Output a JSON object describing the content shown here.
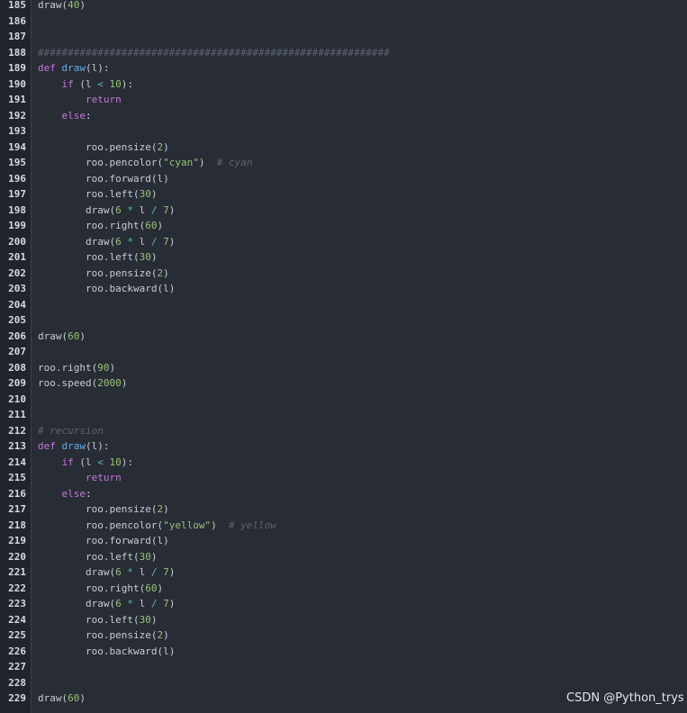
{
  "colors": {
    "background": "#282c34",
    "gutter": "#21252b",
    "line_number": "#d7dae0",
    "plain": "#c8ccd4",
    "keyword": "#c678dd",
    "function": "#61afef",
    "number": "#98c379",
    "string": "#98c379",
    "operator": "#56b6c2",
    "comment": "#5c6370"
  },
  "watermark": "CSDN @Python_trys",
  "lines": [
    {
      "num": "185",
      "tokens": [
        {
          "t": "draw(",
          "c": "plain"
        },
        {
          "t": "40",
          "c": "num"
        },
        {
          "t": ")",
          "c": "plain"
        }
      ]
    },
    {
      "num": "186",
      "tokens": []
    },
    {
      "num": "187",
      "tokens": []
    },
    {
      "num": "188",
      "tokens": [
        {
          "t": "###########################################################",
          "c": "com"
        }
      ]
    },
    {
      "num": "189",
      "tokens": [
        {
          "t": "def ",
          "c": "kw"
        },
        {
          "t": "draw",
          "c": "fn"
        },
        {
          "t": "(l):",
          "c": "plain"
        }
      ]
    },
    {
      "num": "190",
      "tokens": [
        {
          "t": "    ",
          "c": "plain"
        },
        {
          "t": "if",
          "c": "kw"
        },
        {
          "t": " (l ",
          "c": "plain"
        },
        {
          "t": "<",
          "c": "op"
        },
        {
          "t": " ",
          "c": "plain"
        },
        {
          "t": "10",
          "c": "num"
        },
        {
          "t": "):",
          "c": "plain"
        }
      ]
    },
    {
      "num": "191",
      "tokens": [
        {
          "t": "        ",
          "c": "plain"
        },
        {
          "t": "return",
          "c": "kw"
        }
      ]
    },
    {
      "num": "192",
      "tokens": [
        {
          "t": "    ",
          "c": "plain"
        },
        {
          "t": "else",
          "c": "kw"
        },
        {
          "t": ":",
          "c": "plain"
        }
      ]
    },
    {
      "num": "193",
      "tokens": []
    },
    {
      "num": "194",
      "tokens": [
        {
          "t": "        roo.pensize(",
          "c": "plain"
        },
        {
          "t": "2",
          "c": "num"
        },
        {
          "t": ")",
          "c": "plain"
        }
      ]
    },
    {
      "num": "195",
      "tokens": [
        {
          "t": "        roo.pencolor(",
          "c": "plain"
        },
        {
          "t": "\"cyan\"",
          "c": "str"
        },
        {
          "t": ")  ",
          "c": "plain"
        },
        {
          "t": "# cyan",
          "c": "com"
        }
      ]
    },
    {
      "num": "196",
      "tokens": [
        {
          "t": "        roo.forward(l)",
          "c": "plain"
        }
      ]
    },
    {
      "num": "197",
      "tokens": [
        {
          "t": "        roo.left(",
          "c": "plain"
        },
        {
          "t": "30",
          "c": "num"
        },
        {
          "t": ")",
          "c": "plain"
        }
      ]
    },
    {
      "num": "198",
      "tokens": [
        {
          "t": "        draw(",
          "c": "plain"
        },
        {
          "t": "6",
          "c": "num"
        },
        {
          "t": " ",
          "c": "plain"
        },
        {
          "t": "*",
          "c": "op"
        },
        {
          "t": " l ",
          "c": "plain"
        },
        {
          "t": "/",
          "c": "op"
        },
        {
          "t": " ",
          "c": "plain"
        },
        {
          "t": "7",
          "c": "num"
        },
        {
          "t": ")",
          "c": "plain"
        }
      ]
    },
    {
      "num": "199",
      "tokens": [
        {
          "t": "        roo.right(",
          "c": "plain"
        },
        {
          "t": "60",
          "c": "num"
        },
        {
          "t": ")",
          "c": "plain"
        }
      ]
    },
    {
      "num": "200",
      "tokens": [
        {
          "t": "        draw(",
          "c": "plain"
        },
        {
          "t": "6",
          "c": "num"
        },
        {
          "t": " ",
          "c": "plain"
        },
        {
          "t": "*",
          "c": "op"
        },
        {
          "t": " l ",
          "c": "plain"
        },
        {
          "t": "/",
          "c": "op"
        },
        {
          "t": " ",
          "c": "plain"
        },
        {
          "t": "7",
          "c": "num"
        },
        {
          "t": ")",
          "c": "plain"
        }
      ]
    },
    {
      "num": "201",
      "tokens": [
        {
          "t": "        roo.left(",
          "c": "plain"
        },
        {
          "t": "30",
          "c": "num"
        },
        {
          "t": ")",
          "c": "plain"
        }
      ]
    },
    {
      "num": "202",
      "tokens": [
        {
          "t": "        roo.pensize(",
          "c": "plain"
        },
        {
          "t": "2",
          "c": "num"
        },
        {
          "t": ")",
          "c": "plain"
        }
      ]
    },
    {
      "num": "203",
      "tokens": [
        {
          "t": "        roo.backward(l)",
          "c": "plain"
        }
      ]
    },
    {
      "num": "204",
      "tokens": []
    },
    {
      "num": "205",
      "tokens": []
    },
    {
      "num": "206",
      "tokens": [
        {
          "t": "draw(",
          "c": "plain"
        },
        {
          "t": "60",
          "c": "num"
        },
        {
          "t": ")",
          "c": "plain"
        }
      ]
    },
    {
      "num": "207",
      "tokens": []
    },
    {
      "num": "208",
      "tokens": [
        {
          "t": "roo.right(",
          "c": "plain"
        },
        {
          "t": "90",
          "c": "num"
        },
        {
          "t": ")",
          "c": "plain"
        }
      ]
    },
    {
      "num": "209",
      "tokens": [
        {
          "t": "roo.speed(",
          "c": "plain"
        },
        {
          "t": "2000",
          "c": "num"
        },
        {
          "t": ")",
          "c": "plain"
        }
      ]
    },
    {
      "num": "210",
      "tokens": []
    },
    {
      "num": "211",
      "tokens": []
    },
    {
      "num": "212",
      "tokens": [
        {
          "t": "# recursion",
          "c": "com"
        }
      ]
    },
    {
      "num": "213",
      "tokens": [
        {
          "t": "def ",
          "c": "kw"
        },
        {
          "t": "draw",
          "c": "fn"
        },
        {
          "t": "(l):",
          "c": "plain"
        }
      ]
    },
    {
      "num": "214",
      "tokens": [
        {
          "t": "    ",
          "c": "plain"
        },
        {
          "t": "if",
          "c": "kw"
        },
        {
          "t": " (l ",
          "c": "plain"
        },
        {
          "t": "<",
          "c": "op"
        },
        {
          "t": " ",
          "c": "plain"
        },
        {
          "t": "10",
          "c": "num"
        },
        {
          "t": "):",
          "c": "plain"
        }
      ]
    },
    {
      "num": "215",
      "tokens": [
        {
          "t": "        ",
          "c": "plain"
        },
        {
          "t": "return",
          "c": "kw"
        }
      ]
    },
    {
      "num": "216",
      "tokens": [
        {
          "t": "    ",
          "c": "plain"
        },
        {
          "t": "else",
          "c": "kw"
        },
        {
          "t": ":",
          "c": "plain"
        }
      ]
    },
    {
      "num": "217",
      "tokens": [
        {
          "t": "        roo.pensize(",
          "c": "plain"
        },
        {
          "t": "2",
          "c": "num"
        },
        {
          "t": ")",
          "c": "plain"
        }
      ]
    },
    {
      "num": "218",
      "tokens": [
        {
          "t": "        roo.pencolor(",
          "c": "plain"
        },
        {
          "t": "\"yellow\"",
          "c": "str"
        },
        {
          "t": ")  ",
          "c": "plain"
        },
        {
          "t": "# yellow",
          "c": "com"
        }
      ]
    },
    {
      "num": "219",
      "tokens": [
        {
          "t": "        roo.forward(l)",
          "c": "plain"
        }
      ]
    },
    {
      "num": "220",
      "tokens": [
        {
          "t": "        roo.left(",
          "c": "plain"
        },
        {
          "t": "30",
          "c": "num"
        },
        {
          "t": ")",
          "c": "plain"
        }
      ]
    },
    {
      "num": "221",
      "tokens": [
        {
          "t": "        draw(",
          "c": "plain"
        },
        {
          "t": "6",
          "c": "num"
        },
        {
          "t": " ",
          "c": "plain"
        },
        {
          "t": "*",
          "c": "op"
        },
        {
          "t": " l ",
          "c": "plain"
        },
        {
          "t": "/",
          "c": "op"
        },
        {
          "t": " ",
          "c": "plain"
        },
        {
          "t": "7",
          "c": "num"
        },
        {
          "t": ")",
          "c": "plain"
        }
      ]
    },
    {
      "num": "222",
      "tokens": [
        {
          "t": "        roo.right(",
          "c": "plain"
        },
        {
          "t": "60",
          "c": "num"
        },
        {
          "t": ")",
          "c": "plain"
        }
      ]
    },
    {
      "num": "223",
      "tokens": [
        {
          "t": "        draw(",
          "c": "plain"
        },
        {
          "t": "6",
          "c": "num"
        },
        {
          "t": " ",
          "c": "plain"
        },
        {
          "t": "*",
          "c": "op"
        },
        {
          "t": " l ",
          "c": "plain"
        },
        {
          "t": "/",
          "c": "op"
        },
        {
          "t": " ",
          "c": "plain"
        },
        {
          "t": "7",
          "c": "num"
        },
        {
          "t": ")",
          "c": "plain"
        }
      ]
    },
    {
      "num": "224",
      "tokens": [
        {
          "t": "        roo.left(",
          "c": "plain"
        },
        {
          "t": "30",
          "c": "num"
        },
        {
          "t": ")",
          "c": "plain"
        }
      ]
    },
    {
      "num": "225",
      "tokens": [
        {
          "t": "        roo.pensize(",
          "c": "plain"
        },
        {
          "t": "2",
          "c": "num"
        },
        {
          "t": ")",
          "c": "plain"
        }
      ]
    },
    {
      "num": "226",
      "tokens": [
        {
          "t": "        roo.backward(l)",
          "c": "plain"
        }
      ]
    },
    {
      "num": "227",
      "tokens": []
    },
    {
      "num": "228",
      "tokens": []
    },
    {
      "num": "229",
      "tokens": [
        {
          "t": "draw(",
          "c": "plain"
        },
        {
          "t": "60",
          "c": "num"
        },
        {
          "t": ")",
          "c": "plain"
        }
      ]
    }
  ]
}
